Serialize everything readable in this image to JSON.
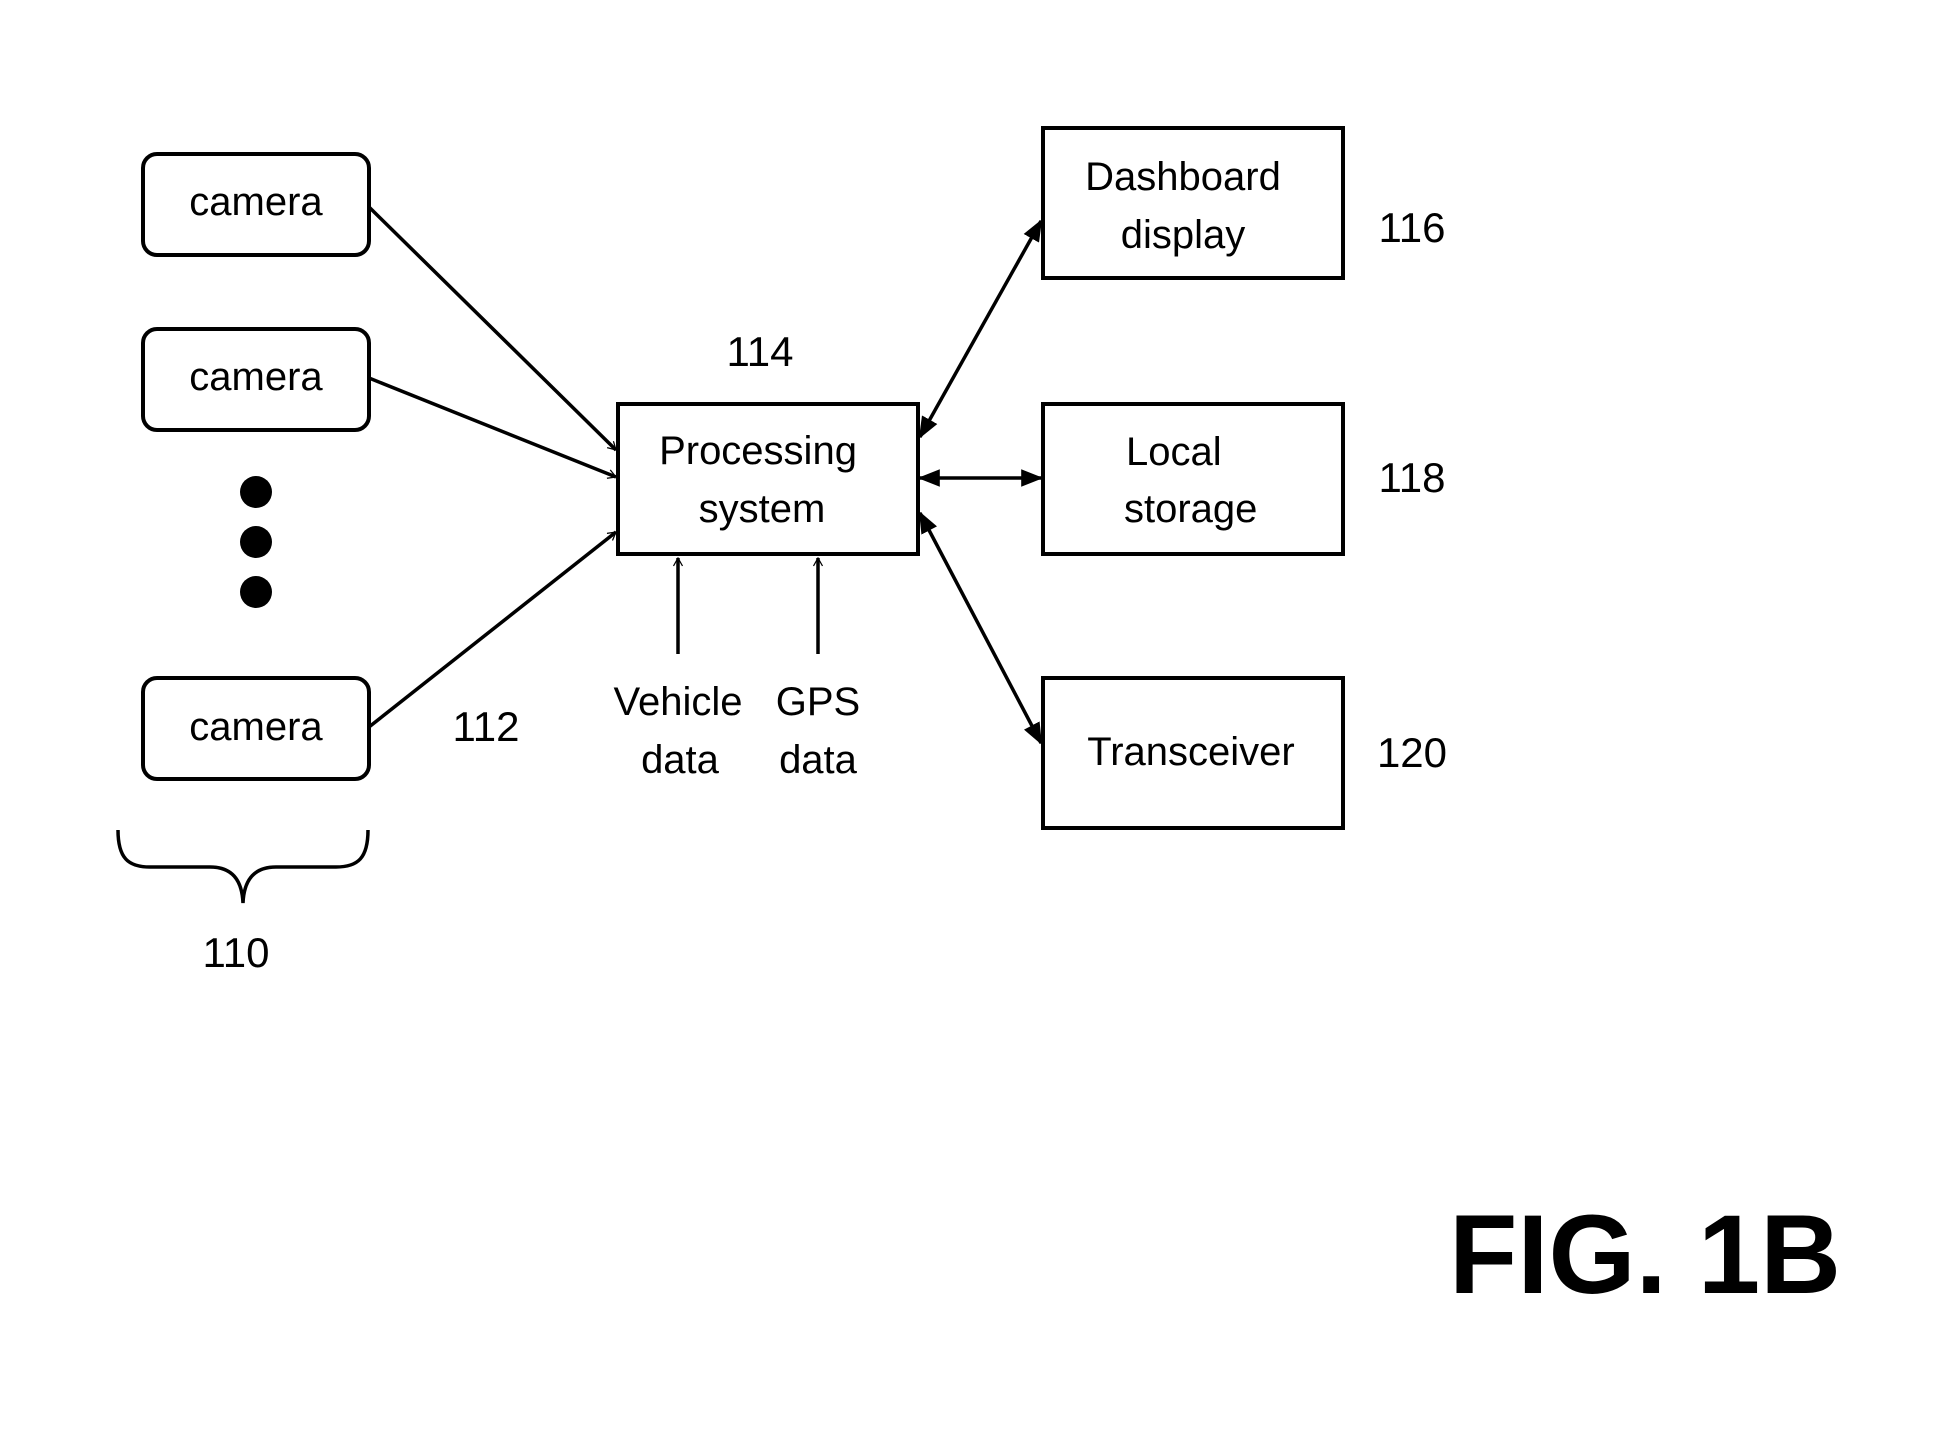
{
  "figure_label": "FIG. 1B",
  "camera_group": {
    "ref": "110",
    "link_ref": "112",
    "cameras": [
      {
        "label": "camera"
      },
      {
        "label": "camera"
      },
      {
        "label": "camera"
      }
    ],
    "ellipsis_dots": 3
  },
  "processing": {
    "ref": "114",
    "lines": [
      "Processing",
      "system"
    ]
  },
  "inputs": [
    {
      "lines": [
        "Vehicle",
        "data"
      ]
    },
    {
      "lines": [
        "GPS",
        "data"
      ]
    }
  ],
  "outputs": [
    {
      "ref": "116",
      "lines": [
        "Dashboard",
        "display"
      ]
    },
    {
      "ref": "118",
      "lines": [
        "Local",
        "storage"
      ]
    },
    {
      "ref": "120",
      "lines": [
        "Transceiver"
      ]
    }
  ],
  "edges": [
    {
      "from": "camera-1",
      "to": "processing",
      "type": "open-arrow"
    },
    {
      "from": "camera-2",
      "to": "processing",
      "type": "open-arrow"
    },
    {
      "from": "camera-3",
      "to": "processing",
      "type": "open-arrow"
    },
    {
      "from": "vehicle-data",
      "to": "processing",
      "type": "open-arrow"
    },
    {
      "from": "gps-data",
      "to": "processing",
      "type": "open-arrow"
    },
    {
      "from": "processing",
      "to": "dashboard-display",
      "type": "bidirectional"
    },
    {
      "from": "processing",
      "to": "local-storage",
      "type": "bidirectional"
    },
    {
      "from": "processing",
      "to": "transceiver",
      "type": "bidirectional"
    }
  ]
}
